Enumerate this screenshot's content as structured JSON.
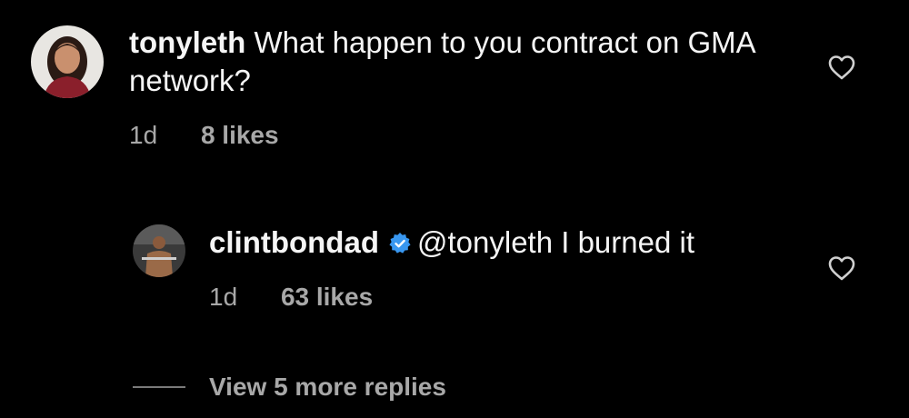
{
  "comments": [
    {
      "username": "tonyleth",
      "text": " What happen to you contract on GMA network?",
      "time": "1d",
      "likes": "8 likes",
      "avatar": "woman-portrait-avatar",
      "like_icon": "heart-outline-icon"
    },
    {
      "username": "clintbondad",
      "verified": true,
      "verified_icon": "verified-badge-icon",
      "text": "@tonyleth I burned it",
      "time": "1d",
      "likes": "63 likes",
      "avatar": "man-gym-avatar",
      "like_icon": "heart-outline-icon"
    }
  ],
  "view_more_label": "View 5 more replies",
  "colors": {
    "background": "#000000",
    "primary_text": "#f5f5f5",
    "secondary_text": "#a8a8a8",
    "verified_blue": "#3897f0"
  }
}
